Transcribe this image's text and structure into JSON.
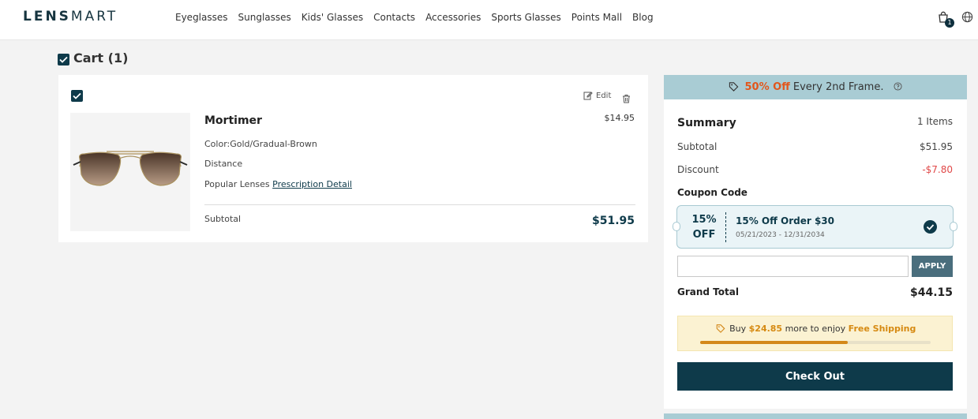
{
  "header": {
    "logo_bold": "LENS",
    "logo_light": "MART",
    "nav": [
      "Eyeglasses",
      "Sunglasses",
      "Kids' Glasses",
      "Contacts",
      "Accessories",
      "Sports Glasses",
      "Points Mall",
      "Blog"
    ],
    "cart_count": "1",
    "icons": [
      "cart-icon",
      "globe-icon"
    ]
  },
  "cart": {
    "title": "Cart (1)",
    "item": {
      "name": "Mortimer",
      "price": "$14.95",
      "color": "Color:Gold/Gradual-Brown",
      "distance": "Distance",
      "lenses_label": "Popular Lenses",
      "prescription_link": "Prescription Detail",
      "edit_label": "Edit",
      "subtotal_label": "Subtotal",
      "subtotal_value": "$51.95"
    }
  },
  "summary": {
    "promo_highlight": "50% Off",
    "promo_text": " Every 2nd Frame.",
    "title": "Summary",
    "items": "1 Items",
    "subtotal_label": "Subtotal",
    "subtotal_value": "$51.95",
    "discount_label": "Discount",
    "discount_value": "-$7.80",
    "coupon_label": "Coupon Code",
    "coupon": {
      "off_pct": "15%",
      "off_word": "OFF",
      "title": "15% Off Order $30",
      "dates": "05/21/2023 - 12/31/2034"
    },
    "code_placeholder": "",
    "apply_label": "APPLY",
    "grand_total_label": "Grand Total",
    "grand_total_value": "$44.15",
    "shipping": {
      "prefix": "Buy ",
      "amount": "$24.85",
      "middle": " more to enjoy ",
      "free": "Free Shipping",
      "progress": 0.64
    },
    "checkout_label": "Check Out"
  },
  "colors": {
    "brand": "#0e3a4a",
    "promo_bg": "#a9ccd4",
    "accent_orange": "#e2561b",
    "discount_red": "#e04848"
  }
}
